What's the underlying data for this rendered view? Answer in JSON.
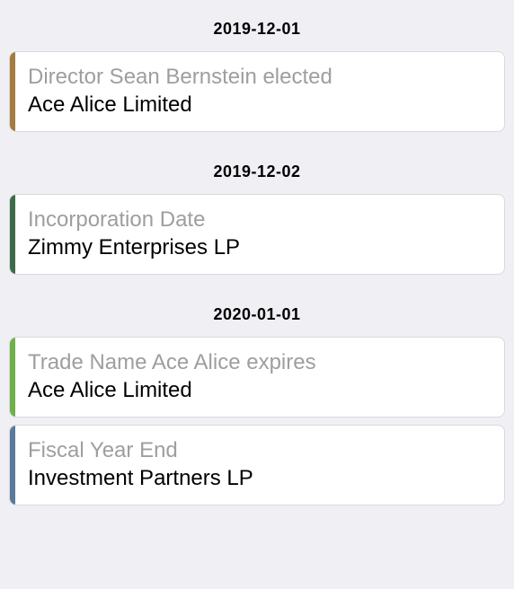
{
  "sections": [
    {
      "date": "2019-12-01",
      "events": [
        {
          "title": "Director Sean Bernstein elected",
          "company": "Ace Alice Limited",
          "color": "#a47c3f"
        }
      ]
    },
    {
      "date": "2019-12-02",
      "events": [
        {
          "title": "Incorporation Date",
          "company": "Zimmy Enterprises LP",
          "color": "#3d6b4a"
        }
      ]
    },
    {
      "date": "2020-01-01",
      "events": [
        {
          "title": "Trade Name Ace Alice expires",
          "company": "Ace Alice Limited",
          "color": "#6fb04a"
        },
        {
          "title": "Fiscal Year End",
          "company": "Investment Partners LP",
          "color": "#5a7a9a"
        }
      ]
    }
  ]
}
